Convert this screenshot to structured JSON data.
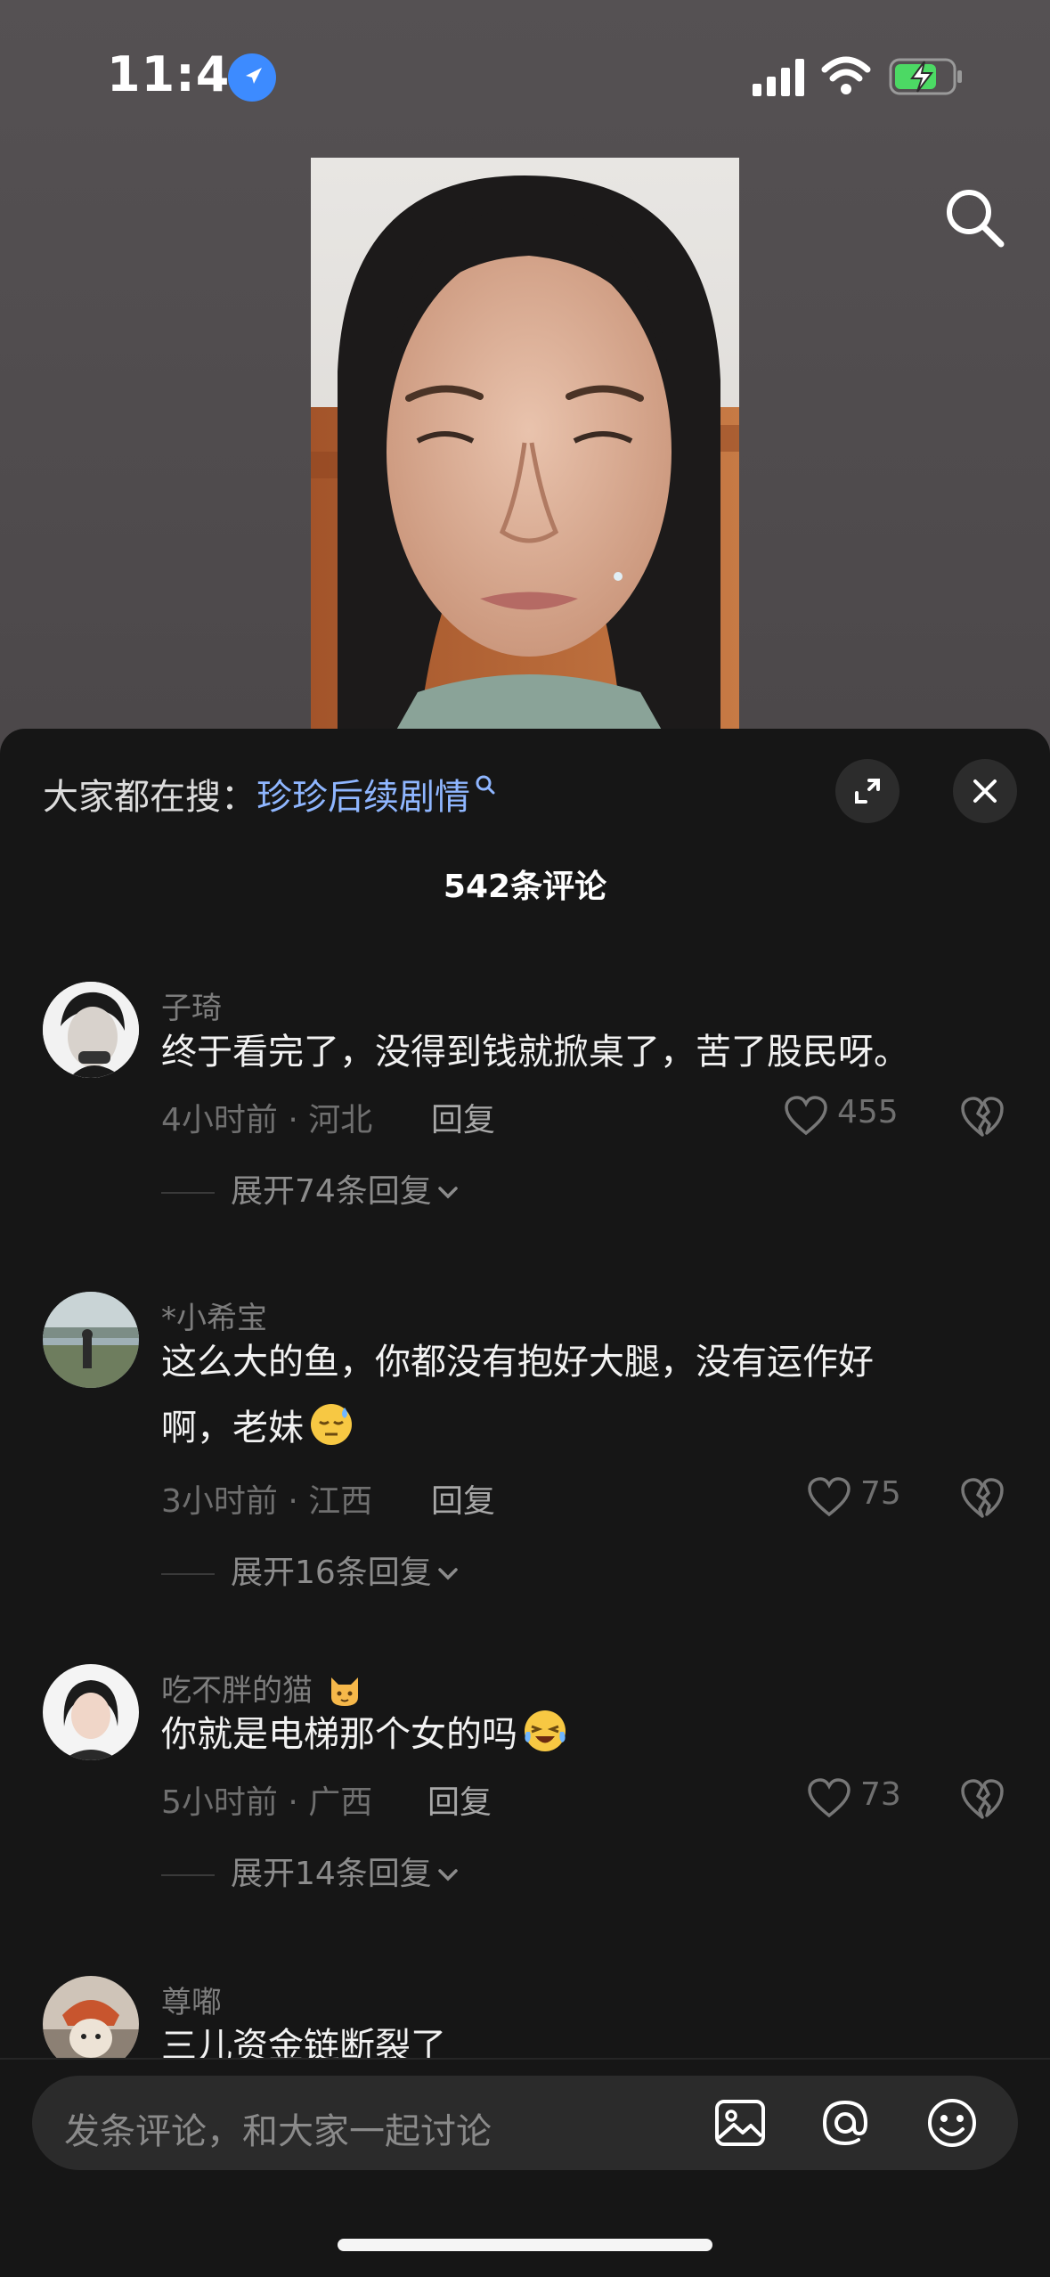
{
  "status_bar": {
    "time": "11:44"
  },
  "sheet": {
    "hot_search_prefix": "大家都在搜：",
    "hot_search_term": "珍珍后续剧情",
    "comment_count": "542条评论"
  },
  "comments": [
    {
      "username": "子琦",
      "text": "终于看完了，没得到钱就掀桌了，苦了股民呀。",
      "time_location": "4小时前 · 河北",
      "reply_label": "回复",
      "likes": "455",
      "expand": "展开74条回复"
    },
    {
      "username": "*小希宝",
      "text_line1": "这么大的鱼，你都没有抱好大腿，没有运作好",
      "text_line2": "啊，老妹",
      "time_location": "3小时前 · 江西",
      "reply_label": "回复",
      "likes": "75",
      "expand": "展开16条回复"
    },
    {
      "username": "吃不胖的猫",
      "text": "你就是电梯那个女的吗",
      "time_location": "5小时前 · 广西",
      "reply_label": "回复",
      "likes": "73",
      "expand": "展开14条回复"
    },
    {
      "username": "尊嘟",
      "text": "三儿资金链断裂了"
    }
  ],
  "input": {
    "placeholder": "发条评论，和大家一起讨论"
  },
  "icons": {
    "location": "location-arrow-icon",
    "search": "search-icon",
    "expand": "expand-icon",
    "close": "close-icon",
    "like": "heart-icon",
    "dislike": "broken-heart-icon",
    "image": "image-icon",
    "mention": "at-icon",
    "emoji": "emoji-icon"
  },
  "colors": {
    "accent_blue": "#8fb6ff",
    "sheet_bg": "#161616",
    "battery_green": "#4cd964"
  }
}
